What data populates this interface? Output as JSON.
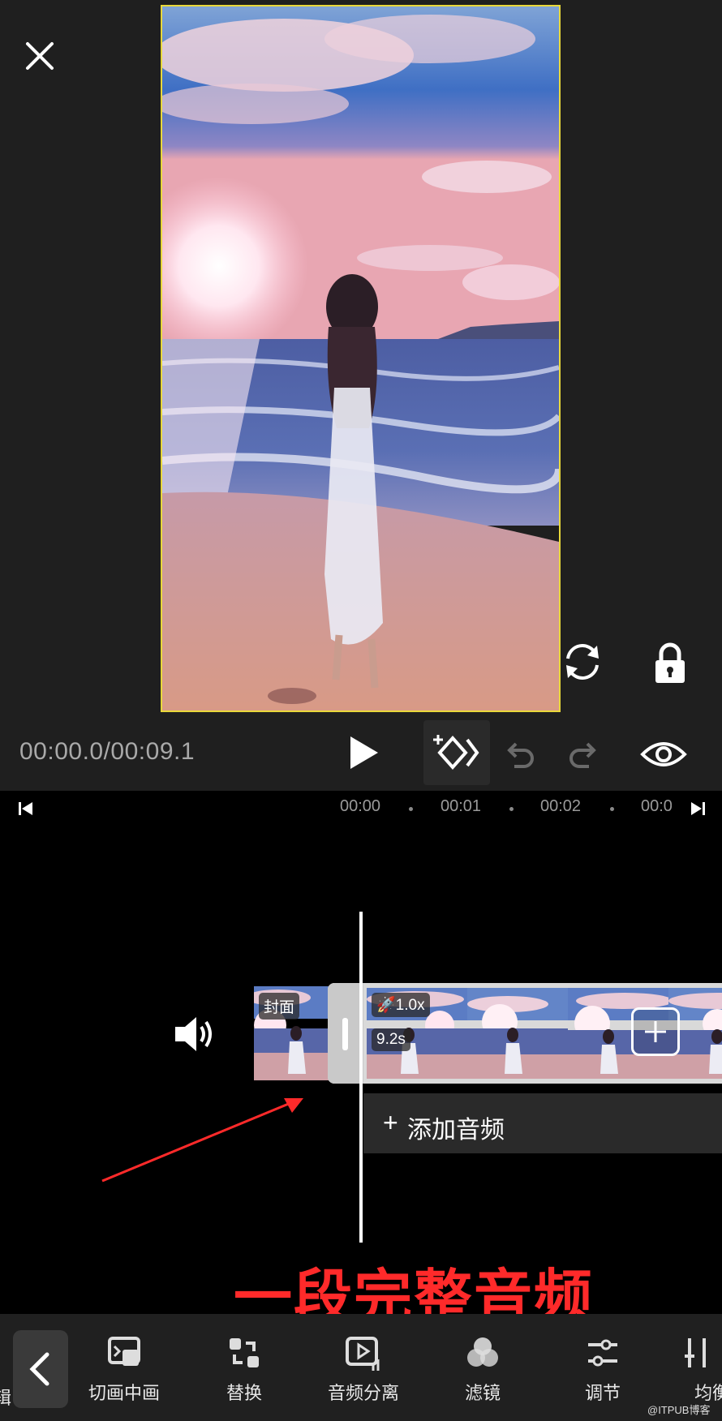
{
  "app": {
    "accent": "#e8d83a"
  },
  "player": {
    "time_display": "00:00.0/00:09.1"
  },
  "ruler": {
    "ticks": [
      "00:00",
      "00:01",
      "00:02",
      "00:0"
    ]
  },
  "timeline": {
    "cover_label": "封面",
    "clip": {
      "speed": "1.0x",
      "duration": "9.2s"
    },
    "add_audio_label": "添加音频"
  },
  "annotation": {
    "text": "一段完整音频",
    "color": "#ff2a2a"
  },
  "toolbar": {
    "partial_left_label": "编辑",
    "items": [
      {
        "icon": "picture-in-picture-icon",
        "label": "切画中画"
      },
      {
        "icon": "replace-icon",
        "label": "替换"
      },
      {
        "icon": "audio-separate-icon",
        "label": "音频分离"
      },
      {
        "icon": "filter-icon",
        "label": "滤镜"
      },
      {
        "icon": "adjust-icon",
        "label": "调节"
      },
      {
        "icon": "equalizer-icon",
        "label": "均衡"
      }
    ]
  },
  "watermark": "@ITPUB博客"
}
